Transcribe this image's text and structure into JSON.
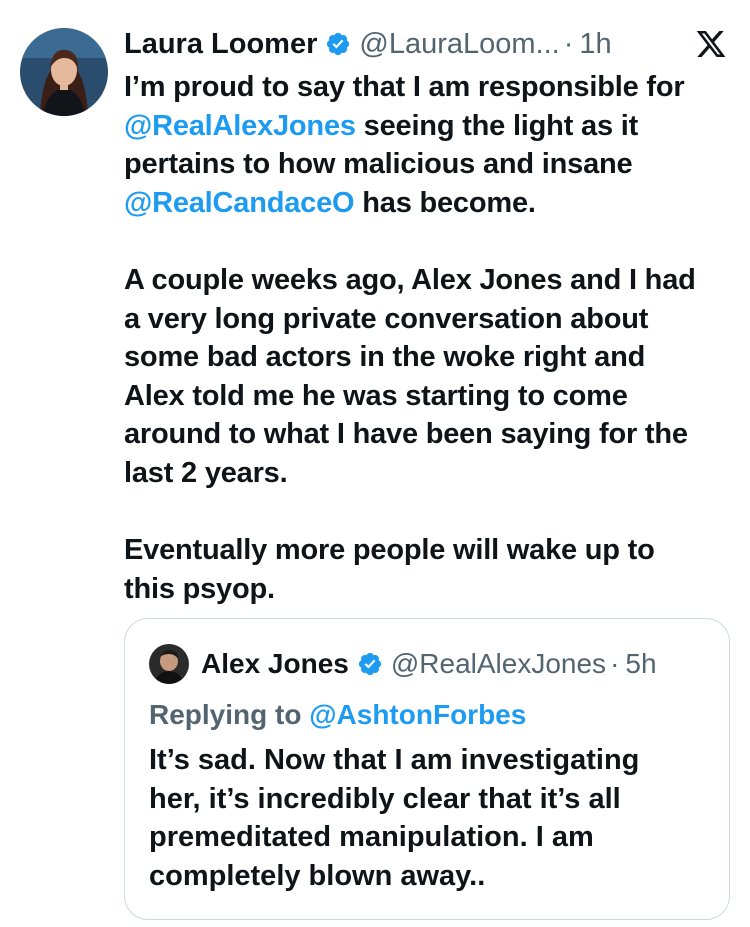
{
  "tweet": {
    "author_name": "Laura Loomer",
    "author_handle": "@LauraLoom...",
    "separator": "·",
    "time": "1h",
    "icons": {
      "verified": "verified-badge-icon",
      "platform": "x-logo-icon"
    },
    "colors": {
      "mention": "#1d9bf0",
      "secondary": "#536471",
      "verified": "#1d9bf0"
    },
    "body": {
      "p1_l1": "I’m proud to say that I am responsible for",
      "p1_l2_mention": "@RealAlexJones",
      "p1_l2_rest": " seeing the light as it",
      "p1_l3": "pertains to how malicious and insane",
      "p1_l4_mention": "@RealCandaceO",
      "p1_l4_rest": " has become.",
      "p2_l1": "A couple weeks ago, Alex Jones and I had",
      "p2_l2": "a very long private conversation about",
      "p2_l3": "some bad actors in the woke right and",
      "p2_l4": "Alex told me he was starting to come",
      "p2_l5": "around to what I have been saying for the",
      "p2_l6": "last 2 years.",
      "p3_l1": "Eventually more people will wake up to",
      "p3_l2": "this psyop."
    }
  },
  "quote": {
    "author_name": "Alex Jones",
    "author_handle": "@RealAlexJones",
    "separator": "·",
    "time": "5h",
    "replying_prefix": "Replying to ",
    "replying_to": "@AshtonForbes",
    "body": {
      "l1": "It’s sad. Now that I am investigating",
      "l2": "her, it’s incredibly clear that it’s all",
      "l3": "premeditated manipulation. I am",
      "l4": "completely blown away.."
    }
  }
}
